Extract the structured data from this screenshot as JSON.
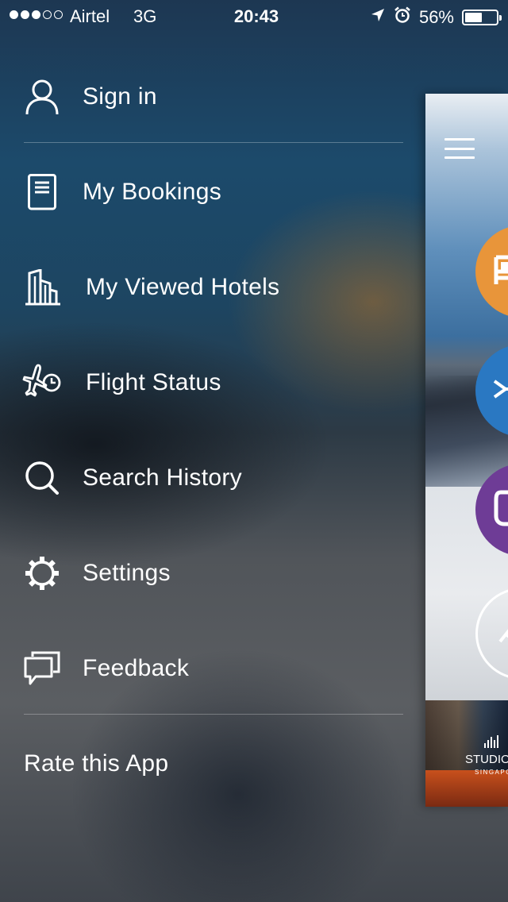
{
  "status_bar": {
    "signal_dots_filled": 3,
    "signal_dots_total": 5,
    "carrier": "Airtel",
    "network": "3G",
    "time": "20:43",
    "battery_percent": "56%",
    "battery_level": 0.56,
    "icons": [
      "location-arrow-icon",
      "alarm-clock-icon"
    ]
  },
  "menu": {
    "items": [
      {
        "label": "Sign in",
        "icon": "user-icon"
      },
      {
        "label": "My Bookings",
        "icon": "document-icon"
      },
      {
        "label": "My Viewed Hotels",
        "icon": "building-icon"
      },
      {
        "label": "Flight Status",
        "icon": "plane-clock-icon"
      },
      {
        "label": "Search History",
        "icon": "search-icon"
      },
      {
        "label": "Settings",
        "icon": "gear-icon"
      },
      {
        "label": "Feedback",
        "icon": "chat-bubbles-icon"
      },
      {
        "label": "Rate this App",
        "icon": ""
      }
    ]
  },
  "app_preview": {
    "icons": [
      "hamburger-menu-icon",
      "hotel-bed-icon",
      "flight-icon",
      "deals-icon",
      "trains-icon"
    ],
    "colors": {
      "hotel": "#e8953a",
      "flight": "#2a78c2",
      "deals": "#6e3c96",
      "trains": "#ffffff"
    },
    "promo": {
      "title": "STUDIO",
      "subtitle": "SINGAPORE"
    }
  }
}
